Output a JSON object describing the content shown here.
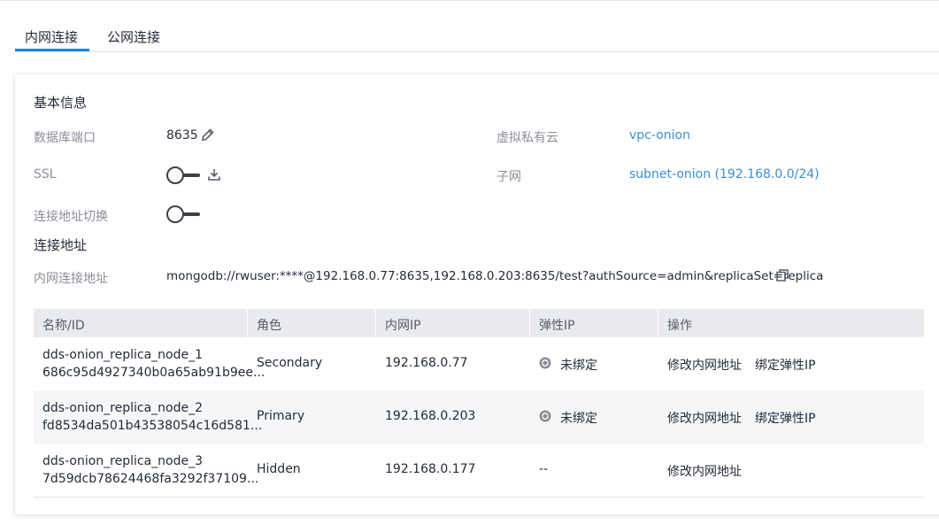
{
  "tabs": [
    {
      "label": "内网连接",
      "active": true
    },
    {
      "label": "公网连接",
      "active": false
    }
  ],
  "basic_info": {
    "title": "基本信息",
    "port_label": "数据库端口",
    "port_value": "8635",
    "ssl_label": "SSL",
    "ssl_enabled": false,
    "switch_label": "连接地址切换",
    "switch_enabled": false,
    "vpc_label": "虚拟私有云",
    "vpc_value": "vpc-onion",
    "subnet_label": "子网",
    "subnet_value": "subnet-onion (192.168.0.0/24)"
  },
  "connection": {
    "title": "连接地址",
    "address_label": "内网连接地址",
    "address_value": "mongodb://rwuser:****@192.168.0.77:8635,192.168.0.203:8635/test?authSource=admin&replicaSet=replica"
  },
  "table": {
    "headers": [
      "名称/ID",
      "角色",
      "内网IP",
      "弹性IP",
      "操作"
    ],
    "rows": [
      {
        "name": "dds-onion_replica_node_1",
        "id": "686c95d4927340b0a65ab91b9ee...",
        "role": "Secondary",
        "ip": "192.168.0.77",
        "eip": "未绑定",
        "eip_icon": "unbound-icon",
        "action1": "修改内网地址",
        "action2": "绑定弹性IP"
      },
      {
        "name": "dds-onion_replica_node_2",
        "id": "fd8534da501b43538054c16d581...",
        "role": "Primary",
        "ip": "192.168.0.203",
        "eip": "未绑定",
        "eip_icon": "unbound-icon",
        "action1": "修改内网地址",
        "action2": "绑定弹性IP"
      },
      {
        "name": "dds-onion_replica_node_3",
        "id": "7d59dcb78624468fa3292f37109...",
        "role": "Hidden",
        "ip": "192.168.0.177",
        "eip": "--",
        "action1": "修改内网地址"
      }
    ]
  },
  "colors": {
    "accent": "#1a86d8",
    "link": "#3e8ed0",
    "header_bg": "#e8eaed"
  }
}
